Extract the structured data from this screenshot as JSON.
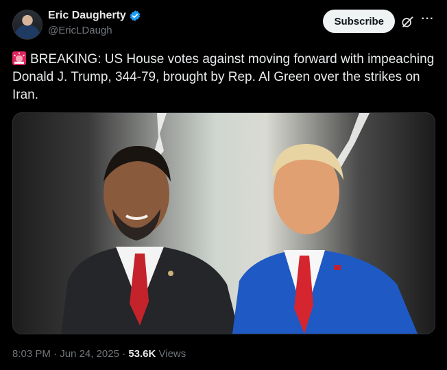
{
  "author": {
    "display_name": "Eric Daugherty",
    "handle": "@EricLDaugh"
  },
  "actions": {
    "subscribe_label": "Subscribe",
    "more_label": "···"
  },
  "tweet": {
    "text": "BREAKING: US House votes against moving forward with impeaching Donald J. Trump, 344-79, brought by Rep. Al Green over the strikes on Iran."
  },
  "meta": {
    "time": "8:03 PM",
    "separator1": " · ",
    "date": "Jun 24, 2025",
    "separator2": " · ",
    "views_count": "53.6K",
    "views_label": " Views"
  },
  "colors": {
    "background": "#000000",
    "verified": "#1d9bf0",
    "muted_text": "#71767b"
  }
}
